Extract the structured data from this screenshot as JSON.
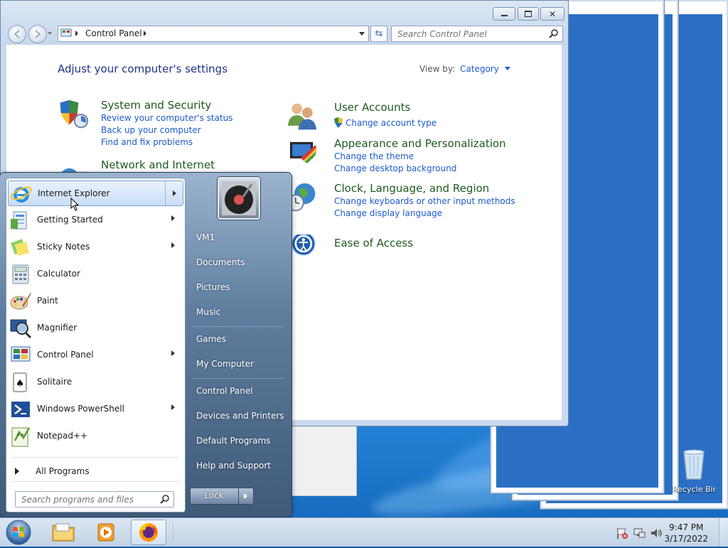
{
  "window": {
    "address_label": "Control Panel",
    "search_placeholder": "Search Control Panel",
    "page_title": "Adjust your computer's settings",
    "view_by_label": "View by:",
    "view_by_value": "Category"
  },
  "categories": {
    "system": {
      "title": "System and Security",
      "links": [
        "Review your computer's status",
        "Back up your computer",
        "Find and fix problems"
      ]
    },
    "network": {
      "title": "Network and Internet"
    },
    "users": {
      "title": "User Accounts",
      "links": [
        "Change account type"
      ]
    },
    "appearance": {
      "title": "Appearance and Personalization",
      "links": [
        "Change the theme",
        "Change desktop background"
      ]
    },
    "clock": {
      "title": "Clock, Language, and Region",
      "links": [
        "Change keyboards or other input methods",
        "Change display language"
      ]
    },
    "ease": {
      "title": "Ease of Access"
    }
  },
  "start_menu": {
    "programs": [
      "Internet Explorer",
      "Getting Started",
      "Sticky Notes",
      "Calculator",
      "Paint",
      "Magnifier",
      "Control Panel",
      "Solitaire",
      "Windows PowerShell",
      "Notepad++"
    ],
    "all_programs": "All Programs",
    "search_placeholder": "Search programs and files",
    "right_links": [
      "VM1",
      "Documents",
      "Pictures",
      "Music",
      "Games",
      "My Computer",
      "Control Panel",
      "Devices and Printers",
      "Default Programs",
      "Help and Support"
    ],
    "lock_label": "Lock"
  },
  "desktop": {
    "recycle_label": "Recycle Bin"
  },
  "taskbar": {
    "time": "9:47 PM",
    "date": "3/17/2022"
  }
}
